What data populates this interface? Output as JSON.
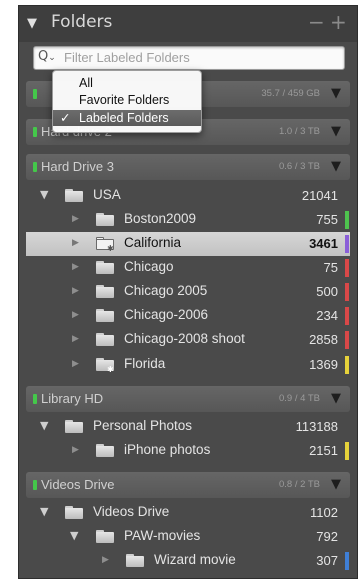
{
  "header": {
    "title": "Folders",
    "minus": "−",
    "plus": "+"
  },
  "search": {
    "placeholder": "Filter Labeled Folders",
    "icon": "Q"
  },
  "dropdown": {
    "options": [
      "All",
      "Favorite Folders",
      "Labeled Folders"
    ],
    "checked": "Labeled Folders",
    "checkmark": "✓"
  },
  "volumes": [
    {
      "name": "",
      "capacity": "35.7 / 459 GB"
    },
    {
      "name": "Hard drive 2",
      "capacity": "1.0 / 3 TB"
    },
    {
      "name": "Hard Drive 3",
      "capacity": "0.6 / 3 TB"
    },
    {
      "name": "Library HD",
      "capacity": "0.9 / 4 TB"
    },
    {
      "name": "Videos Drive",
      "capacity": "0.8 / 2 TB"
    }
  ],
  "folders": [
    {
      "name": "USA",
      "count": "21041",
      "label_color": ""
    },
    {
      "name": "Boston2009",
      "count": "755",
      "label_color": "#4ec24e"
    },
    {
      "name": "California",
      "count": "3461",
      "label_color": "#8a5ed8",
      "selected": true
    },
    {
      "name": "Chicago",
      "count": "75",
      "label_color": "#d94848"
    },
    {
      "name": "Chicago 2005",
      "count": "500",
      "label_color": "#d94848"
    },
    {
      "name": "Chicago-2006",
      "count": "234",
      "label_color": "#d94848"
    },
    {
      "name": "Chicago-2008 shoot",
      "count": "2858",
      "label_color": "#d94848"
    },
    {
      "name": "Florida",
      "count": "1369",
      "label_color": "#e6d23a"
    },
    {
      "name": "Personal Photos",
      "count": "113188",
      "label_color": ""
    },
    {
      "name": "iPhone photos",
      "count": "2151",
      "label_color": "#e6d23a"
    },
    {
      "name": "Videos Drive",
      "count": "1102",
      "label_color": ""
    },
    {
      "name": "PAW-movies",
      "count": "792",
      "label_color": ""
    },
    {
      "name": "Wizard movie",
      "count": "307",
      "label_color": "#3f7fd6"
    }
  ],
  "colors": {
    "panel_bg": "#4a4a4a",
    "selection": "#c9c9c9",
    "volume_led": "#44c84a"
  }
}
